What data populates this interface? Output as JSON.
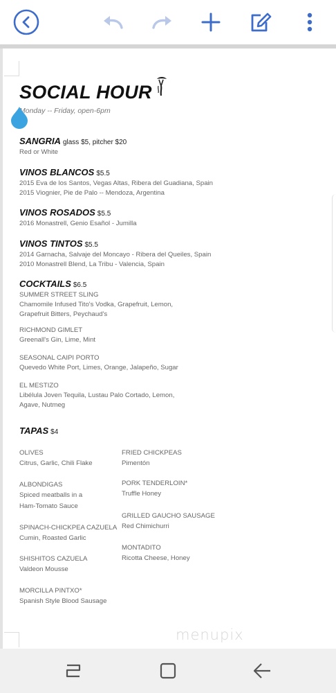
{
  "toolbar": {
    "back_icon": "circle-chevron-left-icon",
    "undo_icon": "undo-icon",
    "redo_icon": "redo-icon",
    "add_icon": "plus-icon",
    "edit_icon": "edit-note-icon",
    "more_icon": "more-vertical-icon",
    "accent_color": "#3d6cc9",
    "disabled_color": "#b9c8e8"
  },
  "document": {
    "title": "SOCIAL HOUR",
    "hours": "Monday -- Friday, open-6pm",
    "sections": [
      {
        "name": "SANGRIA",
        "price": "glass $5, pitcher $20",
        "lines": [
          "Red or White"
        ]
      },
      {
        "name": "VINOS BLANCOS",
        "price": "$5.5",
        "lines": [
          "2015 Eva de los Santos, Vegas Altas, Ribera del Guadiana, Spain",
          "2015 Viognier, Pie de Palo -- Mendoza, Argentina"
        ]
      },
      {
        "name": "VINOS ROSADOS",
        "price": "$5.5",
        "lines": [
          "2016 Monastrell, Genio Esañol - Jumilla"
        ]
      },
      {
        "name": "VINOS TINTOS",
        "price": "$5.5",
        "lines": [
          "2014 Garnacha, Salvaje del Moncayo - Ribera del Queiles, Spain",
          "2010 Monastrell Blend, La Tribu - Valencia, Spain"
        ]
      },
      {
        "name": "COCKTAILS",
        "price": "$6.5",
        "cocktails": [
          {
            "name": "SUMMER STREET SLING",
            "lines": [
              "Chamomile Infused Tito's Vodka, Grapefruit, Lemon,",
              "Grapefruit Bitters, Peychaud's"
            ]
          },
          {
            "name": "RICHMOND GIMLET",
            "lines": [
              "Greenall's Gin, Lime, Mint"
            ]
          },
          {
            "name": "SEASONAL CAIPI PORTO",
            "lines": [
              "Quevedo White Port, Limes, Orange, Jalapeño, Sugar"
            ]
          },
          {
            "name": "EL MESTIZO",
            "lines": [
              "Libélula Joven Tequila, Lustau Palo Cortado, Lemon,",
              "Agave, Nutmeg"
            ]
          }
        ]
      },
      {
        "name": "TAPAS",
        "price": "$4",
        "left": [
          {
            "name": "OLIVES",
            "lines": [
              "Citrus, Garlic, Chili Flake"
            ]
          },
          {
            "name": "ALBONDIGAS",
            "lines": [
              "Spiced meatballs in a",
              "Ham-Tomato Sauce"
            ]
          },
          {
            "name": "SPINACH-CHICKPEA CAZUELA",
            "lines": [
              "Cumin, Roasted Garlic"
            ]
          },
          {
            "name": "SHISHITOS CAZUELA",
            "lines": [
              "Valdeon Mousse"
            ]
          },
          {
            "name": "MORCILLA PINTXO*",
            "lines": [
              "Spanish Style Blood Sausage"
            ]
          }
        ],
        "right": [
          {
            "name": "FRIED CHICKPEAS",
            "lines": [
              "Pimentón"
            ]
          },
          {
            "name": "PORK TENDERLOIN*",
            "lines": [
              "Truffle Honey"
            ]
          },
          {
            "name": "GRILLED GAUCHO SAUSAGE",
            "lines": [
              "Red Chimichurri"
            ]
          },
          {
            "name": "MONTADITO",
            "lines": [
              "Ricotta Cheese, Honey"
            ]
          }
        ]
      }
    ],
    "watermark": "menupix",
    "drop_color": "#3aa3e0"
  },
  "navbar": {
    "recents_icon": "recent-apps-icon",
    "home_icon": "home-square-icon",
    "back_icon": "back-arrow-icon"
  }
}
